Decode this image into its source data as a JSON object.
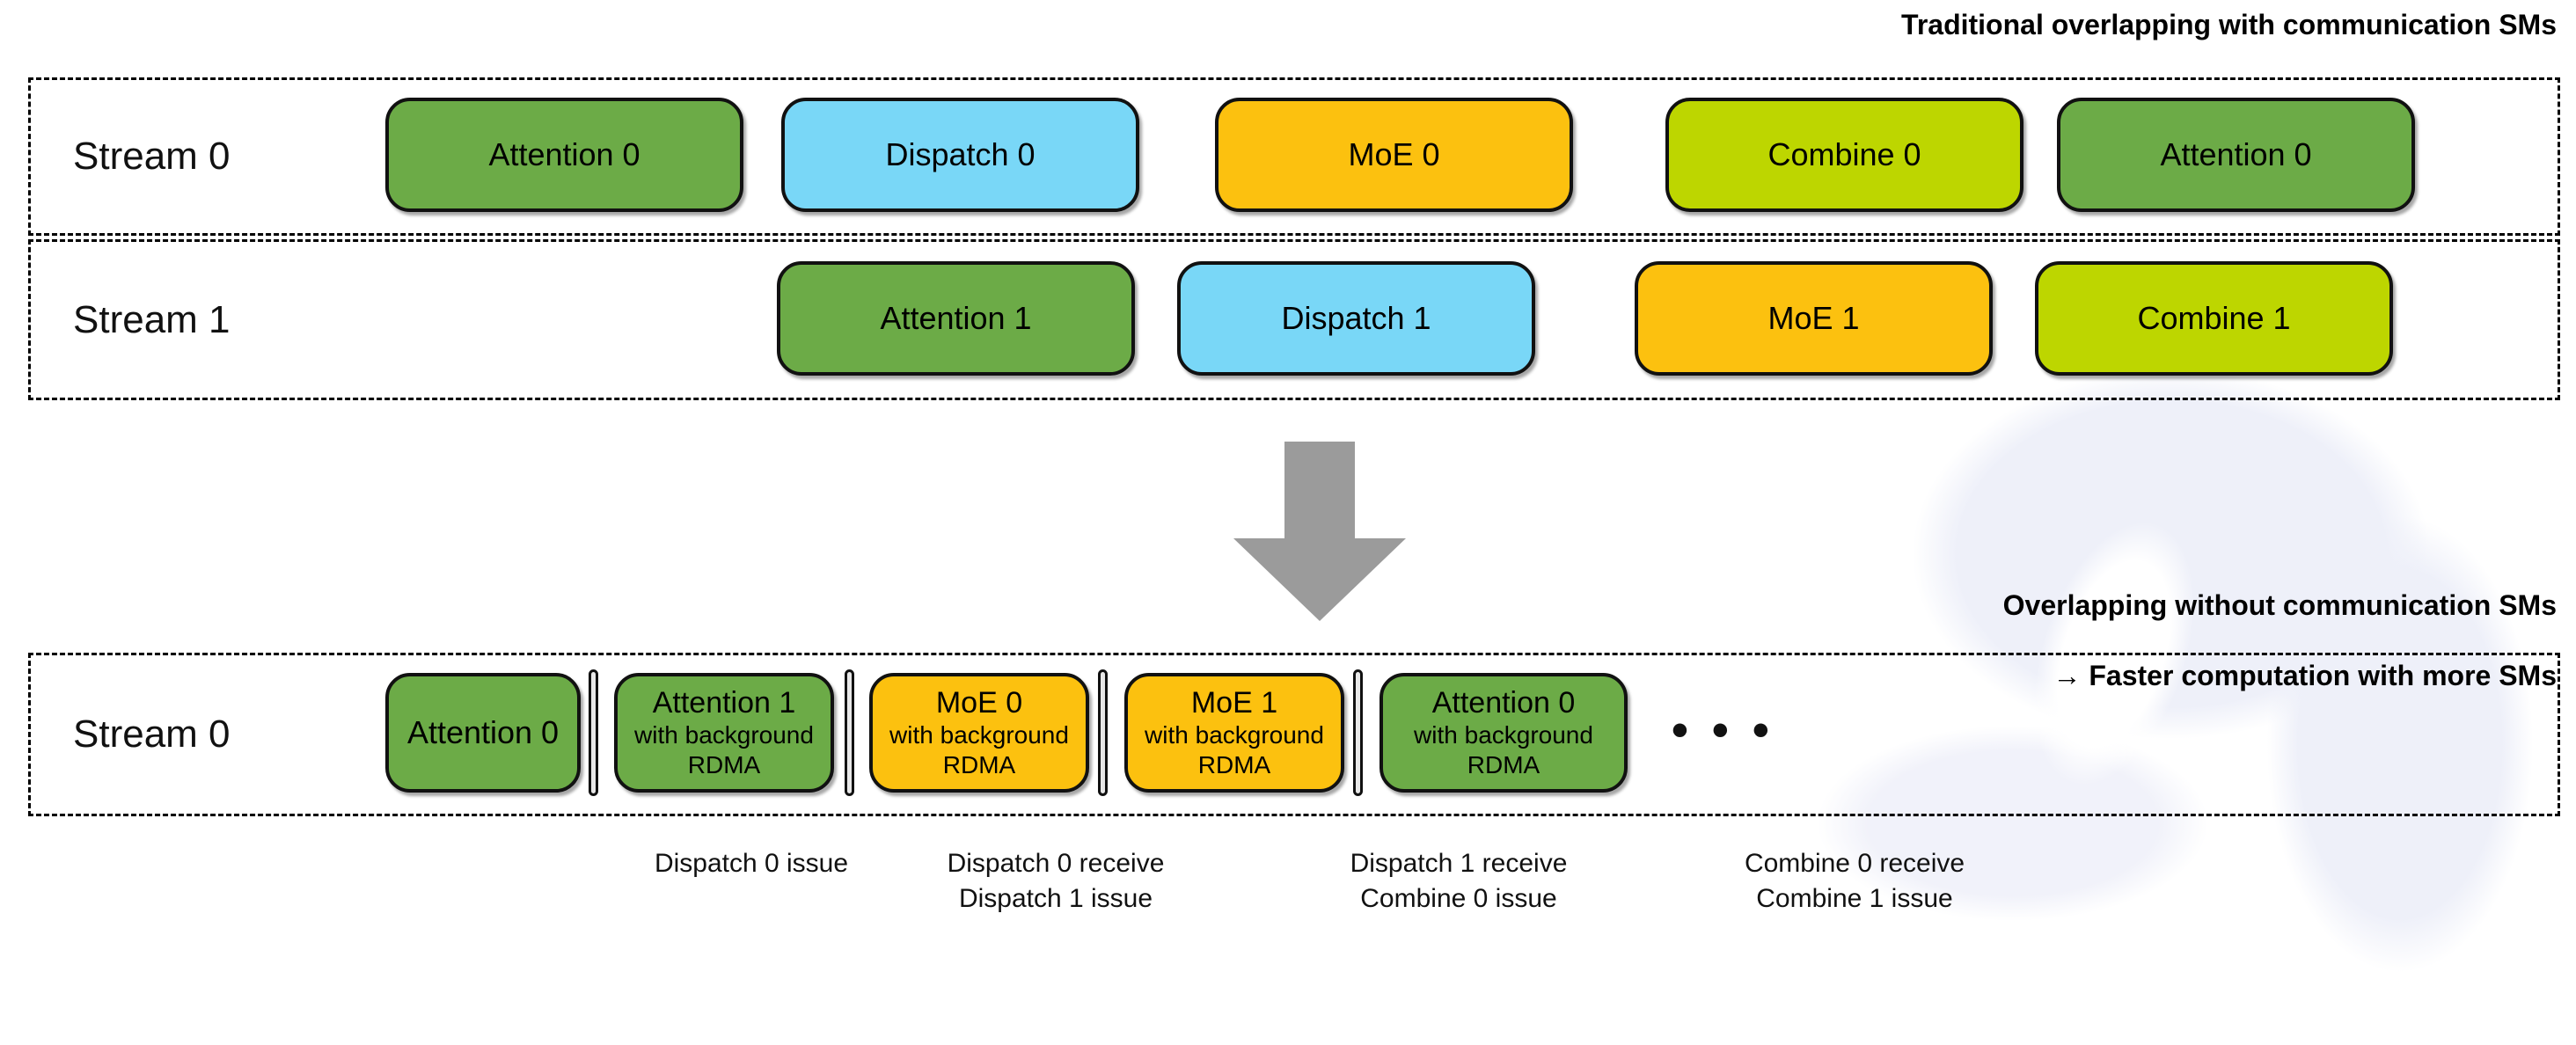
{
  "colors": {
    "attention": "#6cab47",
    "dispatch": "#79d7f7",
    "moe": "#fcc10f",
    "combine": "#bdd600",
    "arrow": "#9b9b9b",
    "outline": "#111111",
    "watermark": "#eef0f9"
  },
  "captions": {
    "top": "Traditional overlapping with communication SMs",
    "bottom_line1": "Overlapping without communication SMs",
    "bottom_line2": "→ Faster computation with more SMs"
  },
  "lanes": [
    {
      "id": "lane-top",
      "label": "Stream 0",
      "blocks": [
        {
          "title": "Attention 0",
          "subtitle": "",
          "kind": "attention"
        },
        {
          "title": "Dispatch 0",
          "subtitle": "",
          "kind": "dispatch"
        },
        {
          "title": "MoE 0",
          "subtitle": "",
          "kind": "moe"
        },
        {
          "title": "Combine 0",
          "subtitle": "",
          "kind": "combine"
        },
        {
          "title": "Attention 0",
          "subtitle": "",
          "kind": "attention"
        }
      ]
    },
    {
      "id": "lane-mid",
      "label": "Stream 1",
      "blocks": [
        {
          "title": "Attention 1",
          "subtitle": "",
          "kind": "attention"
        },
        {
          "title": "Dispatch 1",
          "subtitle": "",
          "kind": "dispatch"
        },
        {
          "title": "MoE 1",
          "subtitle": "",
          "kind": "moe"
        },
        {
          "title": "Combine 1",
          "subtitle": "",
          "kind": "combine"
        }
      ]
    },
    {
      "id": "lane-bottom",
      "label": "Stream 0",
      "ellipsis": "• • •",
      "blocks": [
        {
          "title": "Attention 0",
          "subtitle": "",
          "kind": "attention"
        },
        {
          "title": "Attention 1",
          "subtitle": "with background RDMA",
          "kind": "attention"
        },
        {
          "title": "MoE 0",
          "subtitle": "with background RDMA",
          "kind": "moe"
        },
        {
          "title": "MoE 1",
          "subtitle": "with background RDMA",
          "kind": "moe"
        },
        {
          "title": "Attention 0",
          "subtitle": "with background RDMA",
          "kind": "attention"
        }
      ]
    }
  ],
  "annotations": [
    {
      "line1": "Dispatch 0 issue",
      "line2": ""
    },
    {
      "line1": "Dispatch 0 receive",
      "line2": "Dispatch 1 issue"
    },
    {
      "line1": "Dispatch 1 receive",
      "line2": "Combine 0 issue"
    },
    {
      "line1": "Combine 0 receive",
      "line2": "Combine 1 issue"
    }
  ],
  "arrow": {
    "direction": "down",
    "name": "transformation-arrow"
  }
}
